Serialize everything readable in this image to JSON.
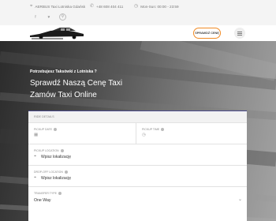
{
  "topbar": {
    "address": "AERBUS Taxi Lotniska Gdańsk",
    "phone": "+48 608 404 411",
    "hours": "Mon-Sun: 00:00 - 23:59",
    "icons": {
      "location": "map-pin-icon",
      "phone": "phone-icon",
      "clock": "clock-icon",
      "facebook": "facebook-icon",
      "twitter": "twitter-icon",
      "search": "search-icon"
    }
  },
  "navbar": {
    "cta_label": "SPRAWDŹ CENĘ",
    "accent_color": "#f08a24"
  },
  "hero": {
    "kicker": "Potrzebujesz Taksówki z Lotniska ?",
    "headline_line1": "Sprawdź Naszą Cenę Taxi",
    "headline_line2": "Zamów Taxi Online"
  },
  "form": {
    "section_title": "RIDE DETAILS",
    "pickup_date_label": "PICKUP DATE",
    "pickup_time_label": "PICKUP TIME",
    "pickup_location_label": "PICKUP LOCATION",
    "pickup_location_placeholder": "Wpisz lokalizację",
    "dropoff_location_label": "DROP-OFF LOCATION",
    "dropoff_location_placeholder": "Wpisz lokalizację",
    "transfer_type_label": "TRANSFER TYPE",
    "transfer_type_value": "One Way"
  }
}
